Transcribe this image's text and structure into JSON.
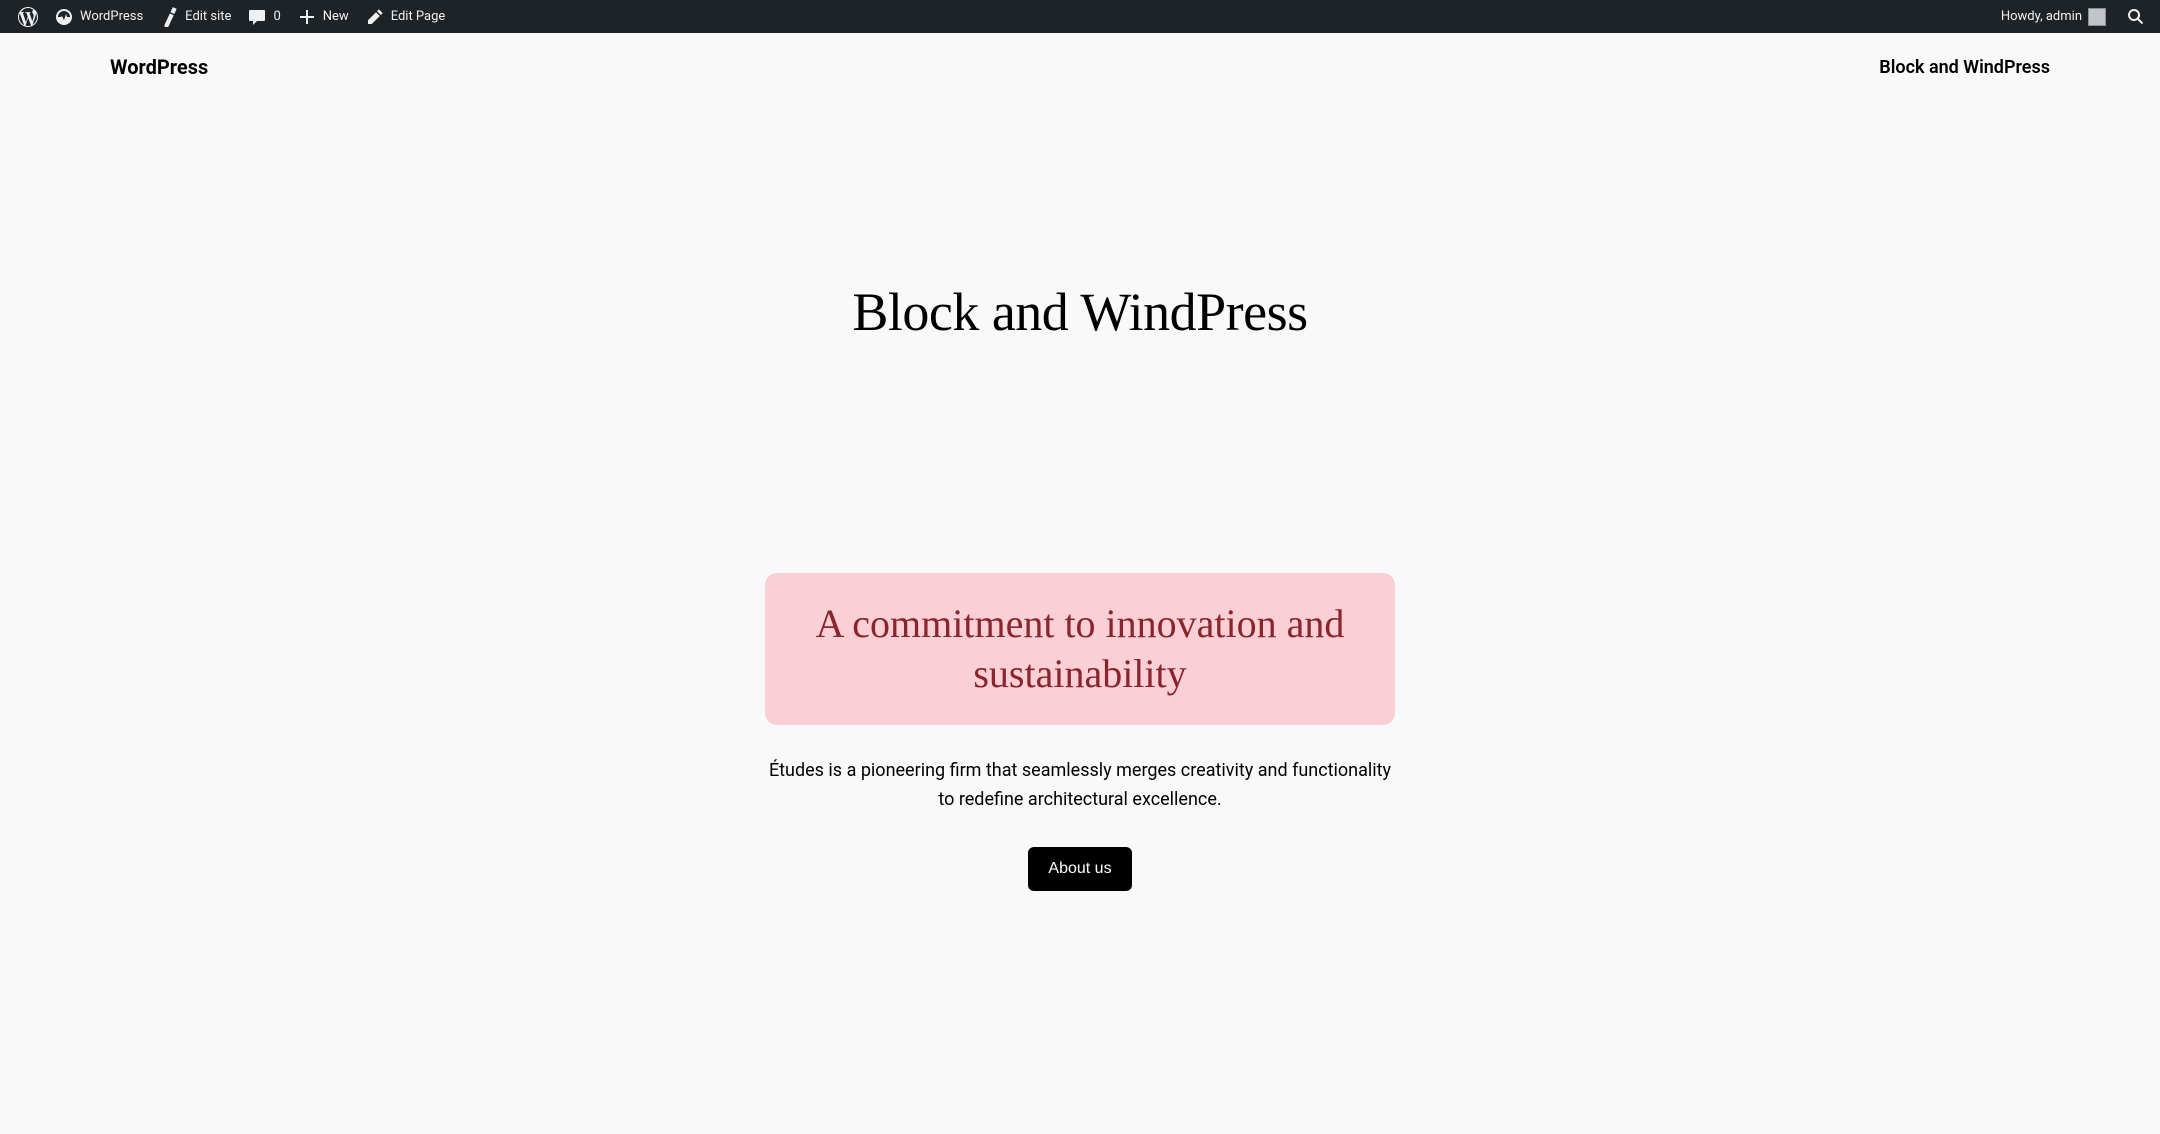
{
  "adminBar": {
    "siteName": "WordPress",
    "editSite": "Edit site",
    "commentsCount": "0",
    "new": "New",
    "editPage": "Edit Page",
    "greeting": "Howdy, admin"
  },
  "header": {
    "siteTitle": "WordPress",
    "navItem": "Block and WindPress"
  },
  "hero": {
    "title": "Block and WindPress"
  },
  "content": {
    "calloutHeading": "A commitment to innovation and sustainability",
    "description": "Études is a pioneering firm that seamlessly merges creativity and functionality to redefine architectural excellence.",
    "buttonLabel": "About us"
  }
}
